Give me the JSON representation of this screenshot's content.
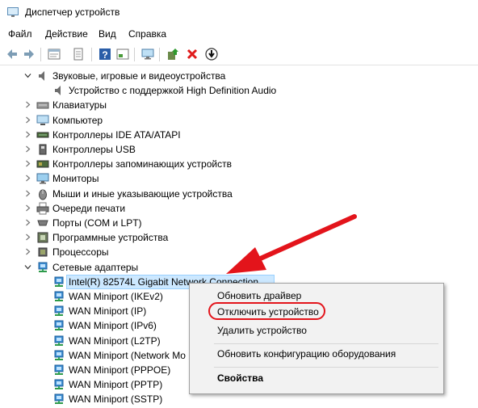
{
  "window": {
    "title": "Диспетчер устройств"
  },
  "menu": [
    "Файл",
    "Действие",
    "Вид",
    "Справка"
  ],
  "toolbar": [
    {
      "name": "back-icon"
    },
    {
      "name": "forward-icon"
    },
    {
      "name": "properties-icon"
    },
    {
      "name": "device-list-icon"
    },
    {
      "name": "help-icon"
    },
    {
      "name": "view-icon"
    },
    {
      "name": "monitor-scan-icon"
    },
    {
      "name": "update-driver-icon"
    },
    {
      "name": "uninstall-icon"
    },
    {
      "name": "download-icon"
    }
  ],
  "tree": [
    {
      "label": "Звуковые, игровые и видеоустройства",
      "state": "expanded",
      "icon": "speaker-icon",
      "indent": 0
    },
    {
      "label": "Устройство с поддержкой High Definition Audio",
      "state": "leaf",
      "icon": "speaker-icon",
      "indent": 1
    },
    {
      "label": "Клавиатуры",
      "state": "collapsed",
      "icon": "keyboard-icon",
      "indent": 0
    },
    {
      "label": "Компьютер",
      "state": "collapsed",
      "icon": "computer-icon",
      "indent": 0
    },
    {
      "label": "Контроллеры IDE ATA/ATAPI",
      "state": "collapsed",
      "icon": "ide-controller-icon",
      "indent": 0
    },
    {
      "label": "Контроллеры USB",
      "state": "collapsed",
      "icon": "usb-icon",
      "indent": 0
    },
    {
      "label": "Контроллеры запоминающих устройств",
      "state": "collapsed",
      "icon": "storage-controller-icon",
      "indent": 0
    },
    {
      "label": "Мониторы",
      "state": "collapsed",
      "icon": "monitor-icon",
      "indent": 0
    },
    {
      "label": "Мыши и иные указывающие устройства",
      "state": "collapsed",
      "icon": "mouse-icon",
      "indent": 0
    },
    {
      "label": "Очереди печати",
      "state": "collapsed",
      "icon": "printer-icon",
      "indent": 0
    },
    {
      "label": "Порты (COM и LPT)",
      "state": "collapsed",
      "icon": "port-icon",
      "indent": 0
    },
    {
      "label": "Программные устройства",
      "state": "collapsed",
      "icon": "software-device-icon",
      "indent": 0
    },
    {
      "label": "Процессоры",
      "state": "collapsed",
      "icon": "processor-icon",
      "indent": 0
    },
    {
      "label": "Сетевые адаптеры",
      "state": "expanded",
      "icon": "network-icon",
      "indent": 0
    },
    {
      "label": "Intel(R) 82574L Gigabit Network Connection",
      "state": "leaf",
      "icon": "network-icon",
      "indent": 1,
      "selected": true
    },
    {
      "label": "WAN Miniport (IKEv2)",
      "state": "leaf",
      "icon": "network-icon",
      "indent": 1
    },
    {
      "label": "WAN Miniport (IP)",
      "state": "leaf",
      "icon": "network-icon",
      "indent": 1
    },
    {
      "label": "WAN Miniport (IPv6)",
      "state": "leaf",
      "icon": "network-icon",
      "indent": 1
    },
    {
      "label": "WAN Miniport (L2TP)",
      "state": "leaf",
      "icon": "network-icon",
      "indent": 1
    },
    {
      "label": "WAN Miniport (Network Mo",
      "state": "leaf",
      "icon": "network-icon",
      "indent": 1
    },
    {
      "label": "WAN Miniport (PPPOE)",
      "state": "leaf",
      "icon": "network-icon",
      "indent": 1
    },
    {
      "label": "WAN Miniport (PPTP)",
      "state": "leaf",
      "icon": "network-icon",
      "indent": 1
    },
    {
      "label": "WAN Miniport (SSTP)",
      "state": "leaf",
      "icon": "network-icon",
      "indent": 1
    }
  ],
  "context_menu": [
    {
      "label": "Обновить драйвер"
    },
    {
      "label": "Отключить устройство",
      "highlighted": true
    },
    {
      "label": "Удалить устройство"
    },
    {
      "separator": true
    },
    {
      "label": "Обновить конфигурацию оборудования"
    },
    {
      "separator": true
    },
    {
      "label": "Свойства",
      "bold": true
    }
  ],
  "colors": {
    "accent_red": "#e3141b",
    "selection": "#cce8ff",
    "network_icon": "#1f7fc4"
  }
}
